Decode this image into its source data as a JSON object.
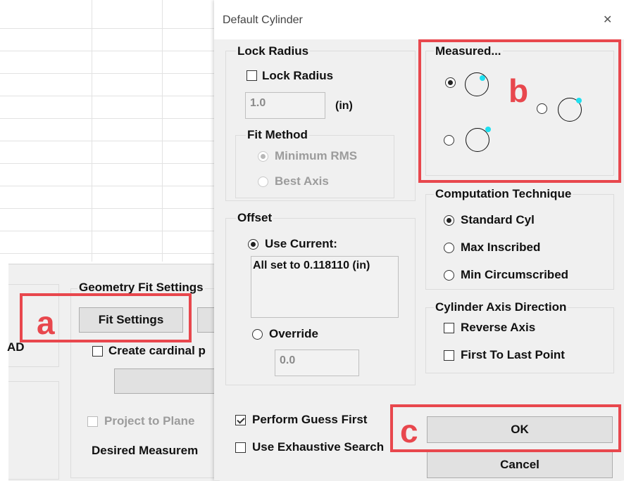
{
  "background": {
    "panel": {
      "group_label": "Geometry Fit Settings",
      "fit_settings_button": "Fit Settings",
      "partial_label_left": "AD",
      "create_cardinal_label": "Create cardinal p",
      "project_to_plane_label": "Project to Plane",
      "desired_measurement_label": "Desired Measurem"
    }
  },
  "dialog": {
    "title": "Default Cylinder",
    "close_glyph": "✕",
    "lock_radius": {
      "group_label": "Lock Radius",
      "checkbox_label": "Lock Radius",
      "value": "1.0",
      "unit": "(in)"
    },
    "fit_method": {
      "group_label": "Fit Method",
      "options": [
        "Minimum RMS",
        "Best Axis"
      ]
    },
    "offset": {
      "group_label": "Offset",
      "use_current_label": "Use Current:",
      "current_text": "All set to 0.118110 (in)",
      "override_label": "Override",
      "override_value": "0.0"
    },
    "measured": {
      "group_label": "Measured..."
    },
    "computation": {
      "group_label": "Computation Technique",
      "options": [
        "Standard Cyl",
        "Max Inscribed",
        "Min Circumscribed"
      ]
    },
    "axis_direction": {
      "group_label": "Cylinder Axis Direction",
      "reverse_axis": "Reverse Axis",
      "first_to_last": "First To Last Point"
    },
    "perform_guess_first": "Perform Guess First",
    "use_exhaustive_search": "Use Exhaustive Search",
    "ok_button": "OK",
    "cancel_button": "Cancel"
  },
  "annotations": {
    "a": "a",
    "b": "b",
    "c": "c",
    "color": "#e8474d"
  }
}
